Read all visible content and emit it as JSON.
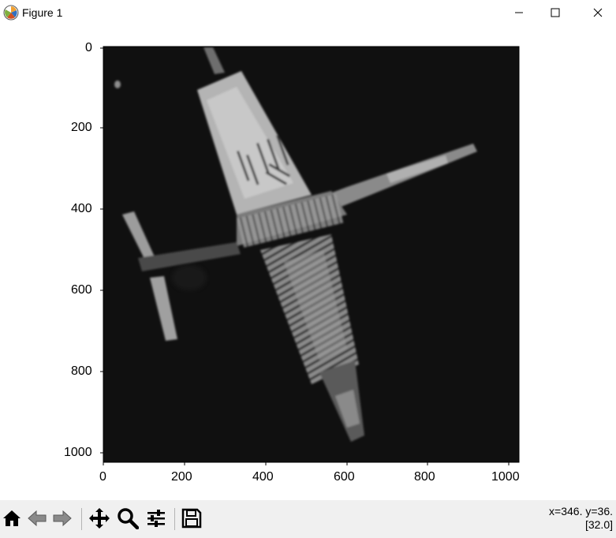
{
  "window": {
    "title": "Figure 1",
    "minimize_icon": "minimize-icon",
    "maximize_icon": "maximize-icon",
    "close_icon": "close-icon"
  },
  "plot": {
    "x_ticks": [
      "0",
      "200",
      "400",
      "600",
      "800",
      "1000"
    ],
    "y_ticks": [
      "0",
      "200",
      "400",
      "600",
      "800",
      "1000"
    ],
    "image": {
      "description_icon": "grayscale-image",
      "background_color": "#0e0e0e",
      "bright_color": "#c8c8c8"
    }
  },
  "toolbar": {
    "buttons": [
      {
        "name": "home-button",
        "icon": "home-icon"
      },
      {
        "name": "back-button",
        "icon": "back-arrow-icon"
      },
      {
        "name": "forward-button",
        "icon": "forward-arrow-icon"
      },
      {
        "name": "pan-button",
        "icon": "pan-icon"
      },
      {
        "name": "zoom-button",
        "icon": "zoom-icon"
      },
      {
        "name": "configure-button",
        "icon": "sliders-icon"
      },
      {
        "name": "save-button",
        "icon": "save-icon"
      }
    ],
    "coords_line1": "x=346. y=36.",
    "coords_line2": "[32.0]"
  }
}
